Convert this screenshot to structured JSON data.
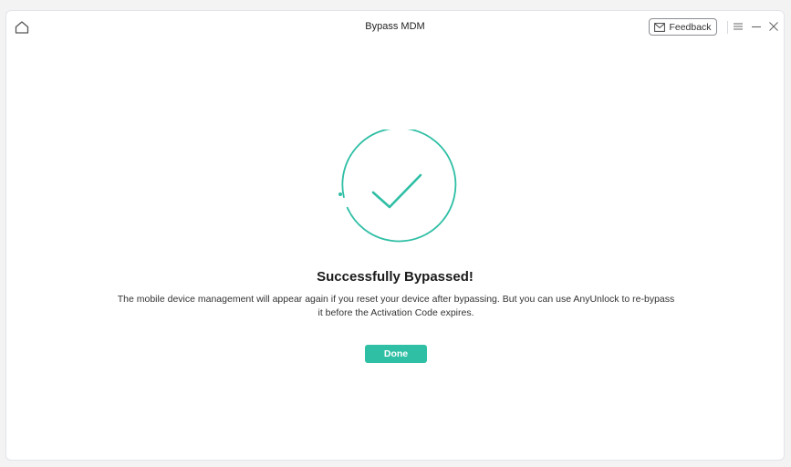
{
  "window": {
    "title": "Bypass MDM",
    "feedback_label": "Feedback"
  },
  "icons": {
    "home": "home-icon",
    "feedback": "mail-icon",
    "menu": "menu-icon",
    "minimize": "minimize-icon",
    "close": "close-icon",
    "status": "check-circle-icon"
  },
  "result": {
    "headline": "Successfully Bypassed!",
    "message": "The mobile device management will appear again if you reset your device after bypassing. But you can use AnyUnlock to re-bypass it before the Activation Code expires.",
    "done_label": "Done"
  },
  "colors": {
    "accent": "#2fbfa5",
    "background": "#f3f3f4"
  }
}
